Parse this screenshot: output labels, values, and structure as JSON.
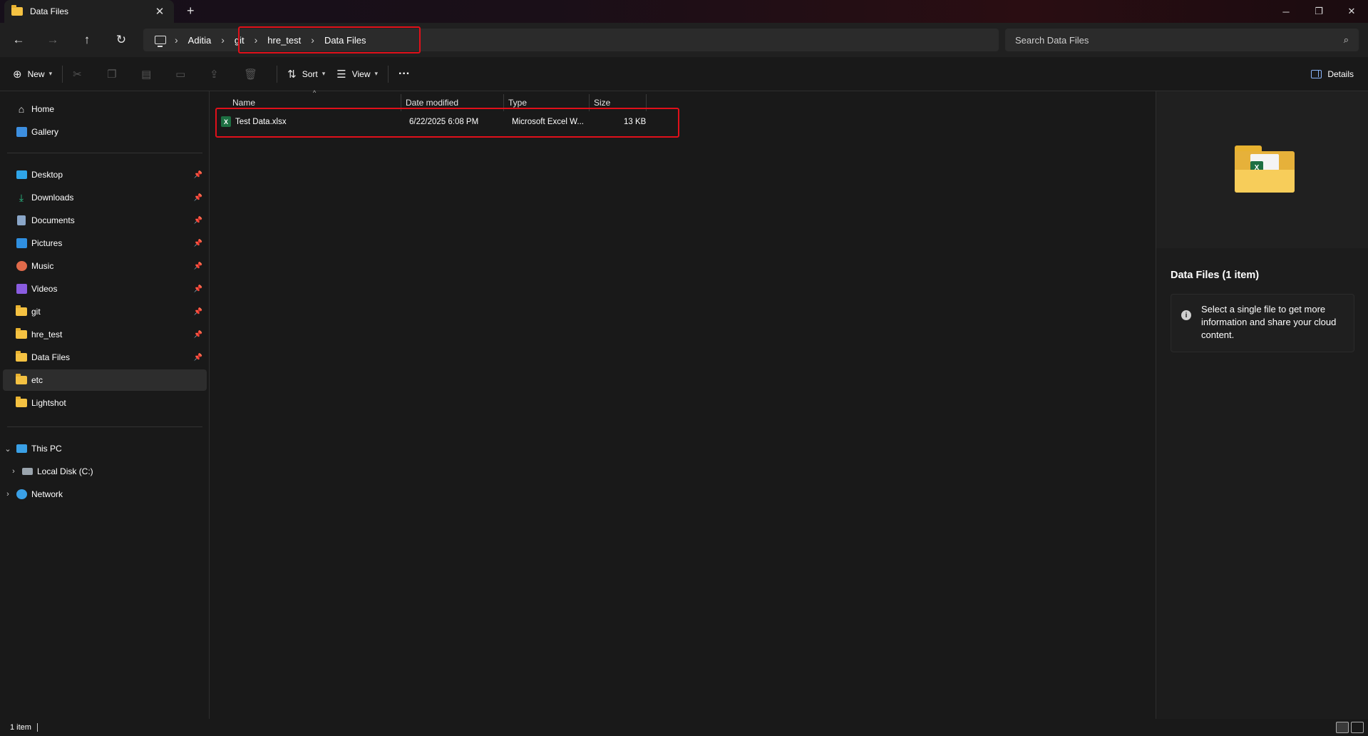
{
  "window": {
    "tab_title": "Data Files",
    "new_tab": "+",
    "tab_close": "✕",
    "minimize": "─",
    "restore": "❐",
    "close": "✕"
  },
  "nav": {
    "back": "←",
    "forward": "→",
    "up": "↑",
    "refresh": "↻",
    "sep": "›"
  },
  "breadcrumb": [
    "Aditia",
    "git",
    "hre_test",
    "Data Files"
  ],
  "search": {
    "placeholder": "Search Data Files",
    "icon": "⌕"
  },
  "toolbar": {
    "new_label": "New",
    "sort_label": "Sort",
    "view_label": "View",
    "more": "···",
    "details_label": "Details"
  },
  "sidebar": {
    "quick": [
      {
        "label": "Home",
        "icon": "home-icon"
      },
      {
        "label": "Gallery",
        "icon": "gallery-icon"
      }
    ],
    "pinned": [
      {
        "label": "Desktop",
        "icon": "desktop-icon"
      },
      {
        "label": "Downloads",
        "icon": "download-icon"
      },
      {
        "label": "Documents",
        "icon": "documents-icon"
      },
      {
        "label": "Pictures",
        "icon": "pictures-icon"
      },
      {
        "label": "Music",
        "icon": "music-icon"
      },
      {
        "label": "Videos",
        "icon": "videos-icon"
      },
      {
        "label": "git",
        "icon": "folder-icon"
      },
      {
        "label": "hre_test",
        "icon": "folder-icon"
      },
      {
        "label": "Data Files",
        "icon": "folder-icon"
      },
      {
        "label": "etc",
        "icon": "folder-icon"
      },
      {
        "label": "Lightshot",
        "icon": "folder-icon"
      }
    ],
    "tree": [
      {
        "label": "This PC",
        "icon": "pc-icon"
      },
      {
        "label": "Local Disk (C:)",
        "icon": "disk-icon"
      },
      {
        "label": "Network",
        "icon": "network-icon"
      }
    ]
  },
  "columns": {
    "name": "Name",
    "date": "Date modified",
    "type": "Type",
    "size": "Size"
  },
  "files": [
    {
      "name": "Test Data.xlsx",
      "date": "6/22/2025 6:08 PM",
      "type": "Microsoft Excel W...",
      "size": "13 KB"
    }
  ],
  "details": {
    "title": "Data Files (1 item)",
    "info": "Select a single file to get more information and share your cloud content.",
    "info_icon": "i"
  },
  "status": {
    "count": "1 item"
  },
  "colors": {
    "highlight": "#e0101a",
    "accent": "#8ab4f8",
    "folder": "#f5c242",
    "excel": "#1d6f42"
  }
}
